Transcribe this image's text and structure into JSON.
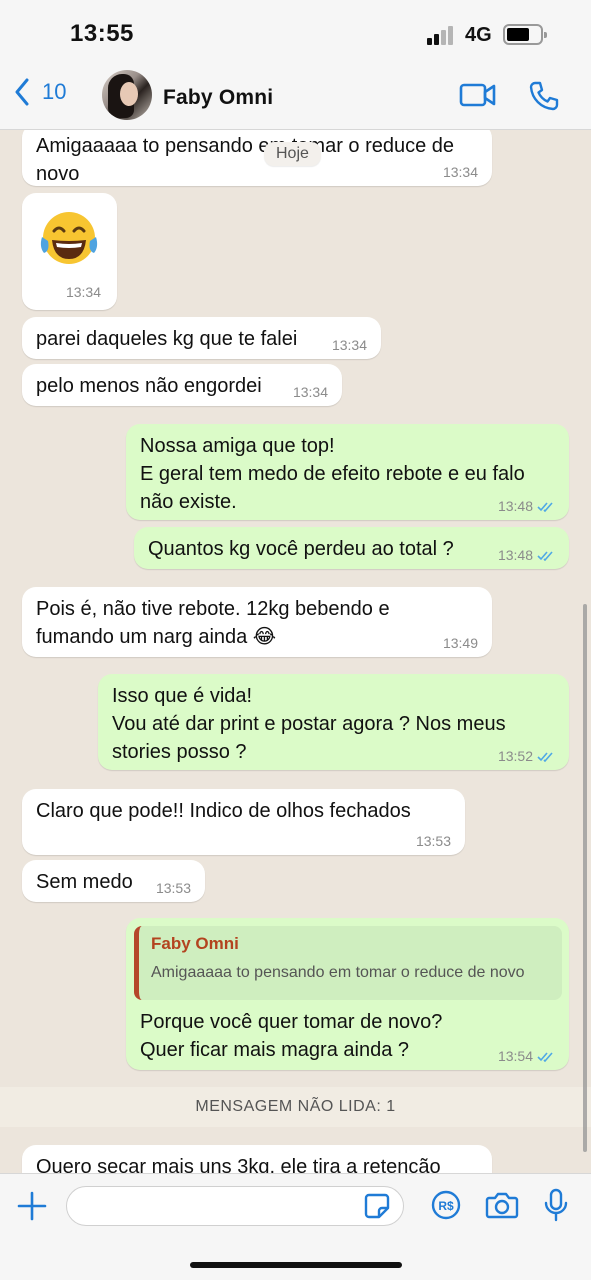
{
  "status_bar": {
    "time": "13:55",
    "network": "4G"
  },
  "header": {
    "back_count": "10",
    "contact_name": "Faby Omni"
  },
  "date_pill": "Hoje",
  "messages": [
    {
      "dir": "in",
      "text": "Amigaaaaa to pensando em tomar o reduce de\nnovo",
      "time": "13:34"
    },
    {
      "dir": "in",
      "emoji": "😂",
      "time": "13:34"
    },
    {
      "dir": "in",
      "text": "parei daqueles kg que te falei",
      "time": "13:34"
    },
    {
      "dir": "in",
      "text": "pelo menos não engordei",
      "time": "13:34"
    },
    {
      "dir": "out",
      "text": "Nossa amiga que top!\nE geral tem medo de efeito rebote e eu falo\nnão existe.",
      "time": "13:48",
      "status": "read"
    },
    {
      "dir": "out",
      "text": "Quantos kg você perdeu ao total ?",
      "time": "13:48",
      "status": "read"
    },
    {
      "dir": "in",
      "text": "Pois é, não tive rebote. 12kg bebendo e\nfumando um narg ainda 😂",
      "time": "13:49"
    },
    {
      "dir": "out",
      "text": "Isso que é vida!\nVou até dar print e postar agora ? Nos meus\nstories posso ?",
      "time": "13:52",
      "status": "read"
    },
    {
      "dir": "in",
      "text": "Claro que pode!! Indico de olhos fechados",
      "time": "13:53"
    },
    {
      "dir": "in",
      "text": "Sem medo",
      "time": "13:53"
    },
    {
      "dir": "out",
      "quote": {
        "author": "Faby Omni",
        "text": "Amigaaaaa to pensando em tomar o reduce de novo"
      },
      "text": "Porque você quer tomar de novo?\nQuer ficar mais magra ainda ?",
      "time": "13:54",
      "status": "read"
    },
    {
      "dir": "in",
      "text": "Quero secar mais uns 3kg, ele tira a retenção",
      "time": ""
    }
  ],
  "unread_banner": "MENSAGEM NÃO LIDA: 1",
  "input": {
    "value": "",
    "placeholder": ""
  },
  "icons": {
    "back": "chevron-left-icon",
    "video": "video-call-icon",
    "phone": "phone-icon",
    "add": "plus-icon",
    "sticker": "sticker-icon",
    "pay": "payment-icon",
    "camera": "camera-icon",
    "mic": "microphone-icon",
    "read": "double-check-icon"
  },
  "colors": {
    "accent": "#1f7bd6",
    "incoming": "#ffffff",
    "outgoing": "#dbfbc8",
    "wallpaper": "#ece5dc",
    "read_ticks": "#4fa8e6",
    "quote_author": "#b3431f"
  }
}
